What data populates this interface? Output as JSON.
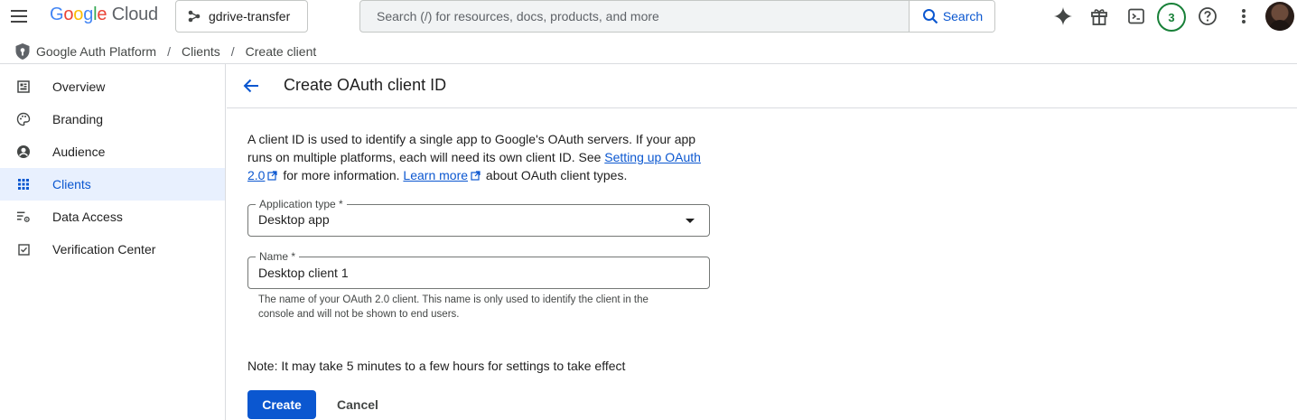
{
  "header": {
    "logo_google": "Google",
    "logo_cloud": "Cloud",
    "project": "gdrive-transfer",
    "search_placeholder": "Search (/) for resources, docs, products, and more",
    "search_button": "Search",
    "notifications_count": "3",
    "icons": [
      "menu-icon",
      "project-icon",
      "search-icon",
      "gemini-icon",
      "gift-icon",
      "cloud-shell-icon",
      "help-icon",
      "more-vert-icon"
    ]
  },
  "breadcrumb": {
    "items": [
      "Google Auth Platform",
      "Clients",
      "Create client"
    ],
    "separator": "/"
  },
  "sidebar": {
    "items": [
      {
        "label": "Overview",
        "icon": "dashboard-icon"
      },
      {
        "label": "Branding",
        "icon": "palette-icon"
      },
      {
        "label": "Audience",
        "icon": "account-circle-icon"
      },
      {
        "label": "Clients",
        "icon": "apps-grid-icon"
      },
      {
        "label": "Data Access",
        "icon": "data-access-icon"
      },
      {
        "label": "Verification Center",
        "icon": "verified-checkbox-icon"
      }
    ],
    "active": "Clients"
  },
  "page": {
    "title": "Create OAuth client ID",
    "description_part1": "A client ID is used to identify a single app to Google's OAuth servers. If your app runs on multiple platforms, each will need its own client ID. See",
    "link1_text": "Setting up OAuth 2.0",
    "description_part2": "for more information.",
    "link2_text": "Learn more",
    "description_part3": "about OAuth client types.",
    "app_type_label": "Application type *",
    "app_type_value": "Desktop app",
    "name_label": "Name *",
    "name_value": "Desktop client 1",
    "name_hint": "The name of your OAuth 2.0 client. This name is only used to identify the client in the console and will not be shown to end users.",
    "note": "Note: It may take 5 minutes to a few hours for settings to take effect",
    "create_button": "Create",
    "cancel_button": "Cancel"
  },
  "colors": {
    "accent": "#0b57d0",
    "active_nav_bg": "#e8f0fe",
    "badge_green": "#188038"
  }
}
